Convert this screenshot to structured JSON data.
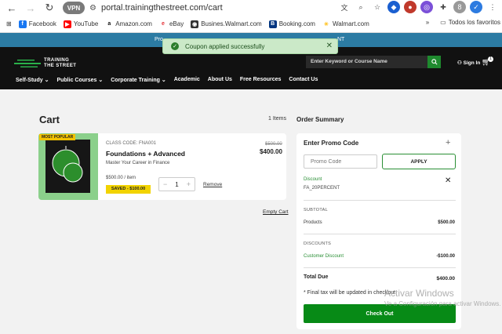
{
  "browser": {
    "url": "portal.trainingthestreet.com/cart",
    "vpn_label": "VPN"
  },
  "bookmarks": {
    "items": [
      {
        "label": "Facebook",
        "color": "#1877f2",
        "glyph": "f"
      },
      {
        "label": "YouTube",
        "color": "#ff0000",
        "glyph": "▶"
      },
      {
        "label": "Amazon.com",
        "color": "#111111",
        "glyph": "a"
      },
      {
        "label": "eBay",
        "color": "#ffffff",
        "glyph": "e"
      },
      {
        "label": "Busines.Walmart.com",
        "color": "#333333",
        "glyph": "◉"
      },
      {
        "label": "Booking.com",
        "color": "#003580",
        "glyph": "B"
      },
      {
        "label": "Walmart.com",
        "color": "#ffc220",
        "glyph": "✳"
      }
    ],
    "overflow": "»",
    "folder_label": "Todos los favoritos"
  },
  "toast": {
    "message": "Coupon applied successfully"
  },
  "promo_banner": {
    "text_left": "Pro",
    "text_right": "NT"
  },
  "header": {
    "logo_line1": "TRAINING",
    "logo_line2": "THE STREET",
    "search_placeholder": "Enter Keyword or Course Name",
    "signin_label": "Sign In",
    "cart_count": "1"
  },
  "nav": {
    "items": [
      "Self-Study",
      "Public Courses",
      "Corporate Training",
      "Academic",
      "About Us",
      "Free Resources",
      "Contact Us"
    ]
  },
  "cart": {
    "title": "Cart",
    "items_count": "1 Items",
    "item": {
      "badge": "MOST POPULAR",
      "class_code": "CLASS CODE: FNA001",
      "name": "Foundations + Advanced",
      "subtitle": "Master Your Career in Finance",
      "per_item": "$500.00 / item",
      "saved": "SAVED - $100.00",
      "quantity": "1",
      "remove_label": "Remove",
      "old_price": "$500.00",
      "new_price": "$400.00"
    },
    "empty_cart_label": "Empty Cart"
  },
  "summary": {
    "title": "Order Summary",
    "promo_heading": "Enter Promo Code",
    "promo_placeholder": "Promo Code",
    "apply_label": "APPLY",
    "discount_label": "Discount",
    "discount_code": "FA_20PERCENT",
    "subtotal_label": "SUBTOTAL",
    "products_label": "Products",
    "products_value": "$500.00",
    "discounts_label": "DISCOUNTS",
    "customer_discount_label": "Customer Discount",
    "customer_discount_value": "-$100.00",
    "total_label": "Total Due",
    "total_value": "$400.00",
    "tax_note": "* Final tax will be updated in checkout",
    "checkout_label": "Check Out"
  },
  "watermark": {
    "line1": "Activar Windows",
    "line2": "Ve a Configuración para activar Windows."
  }
}
